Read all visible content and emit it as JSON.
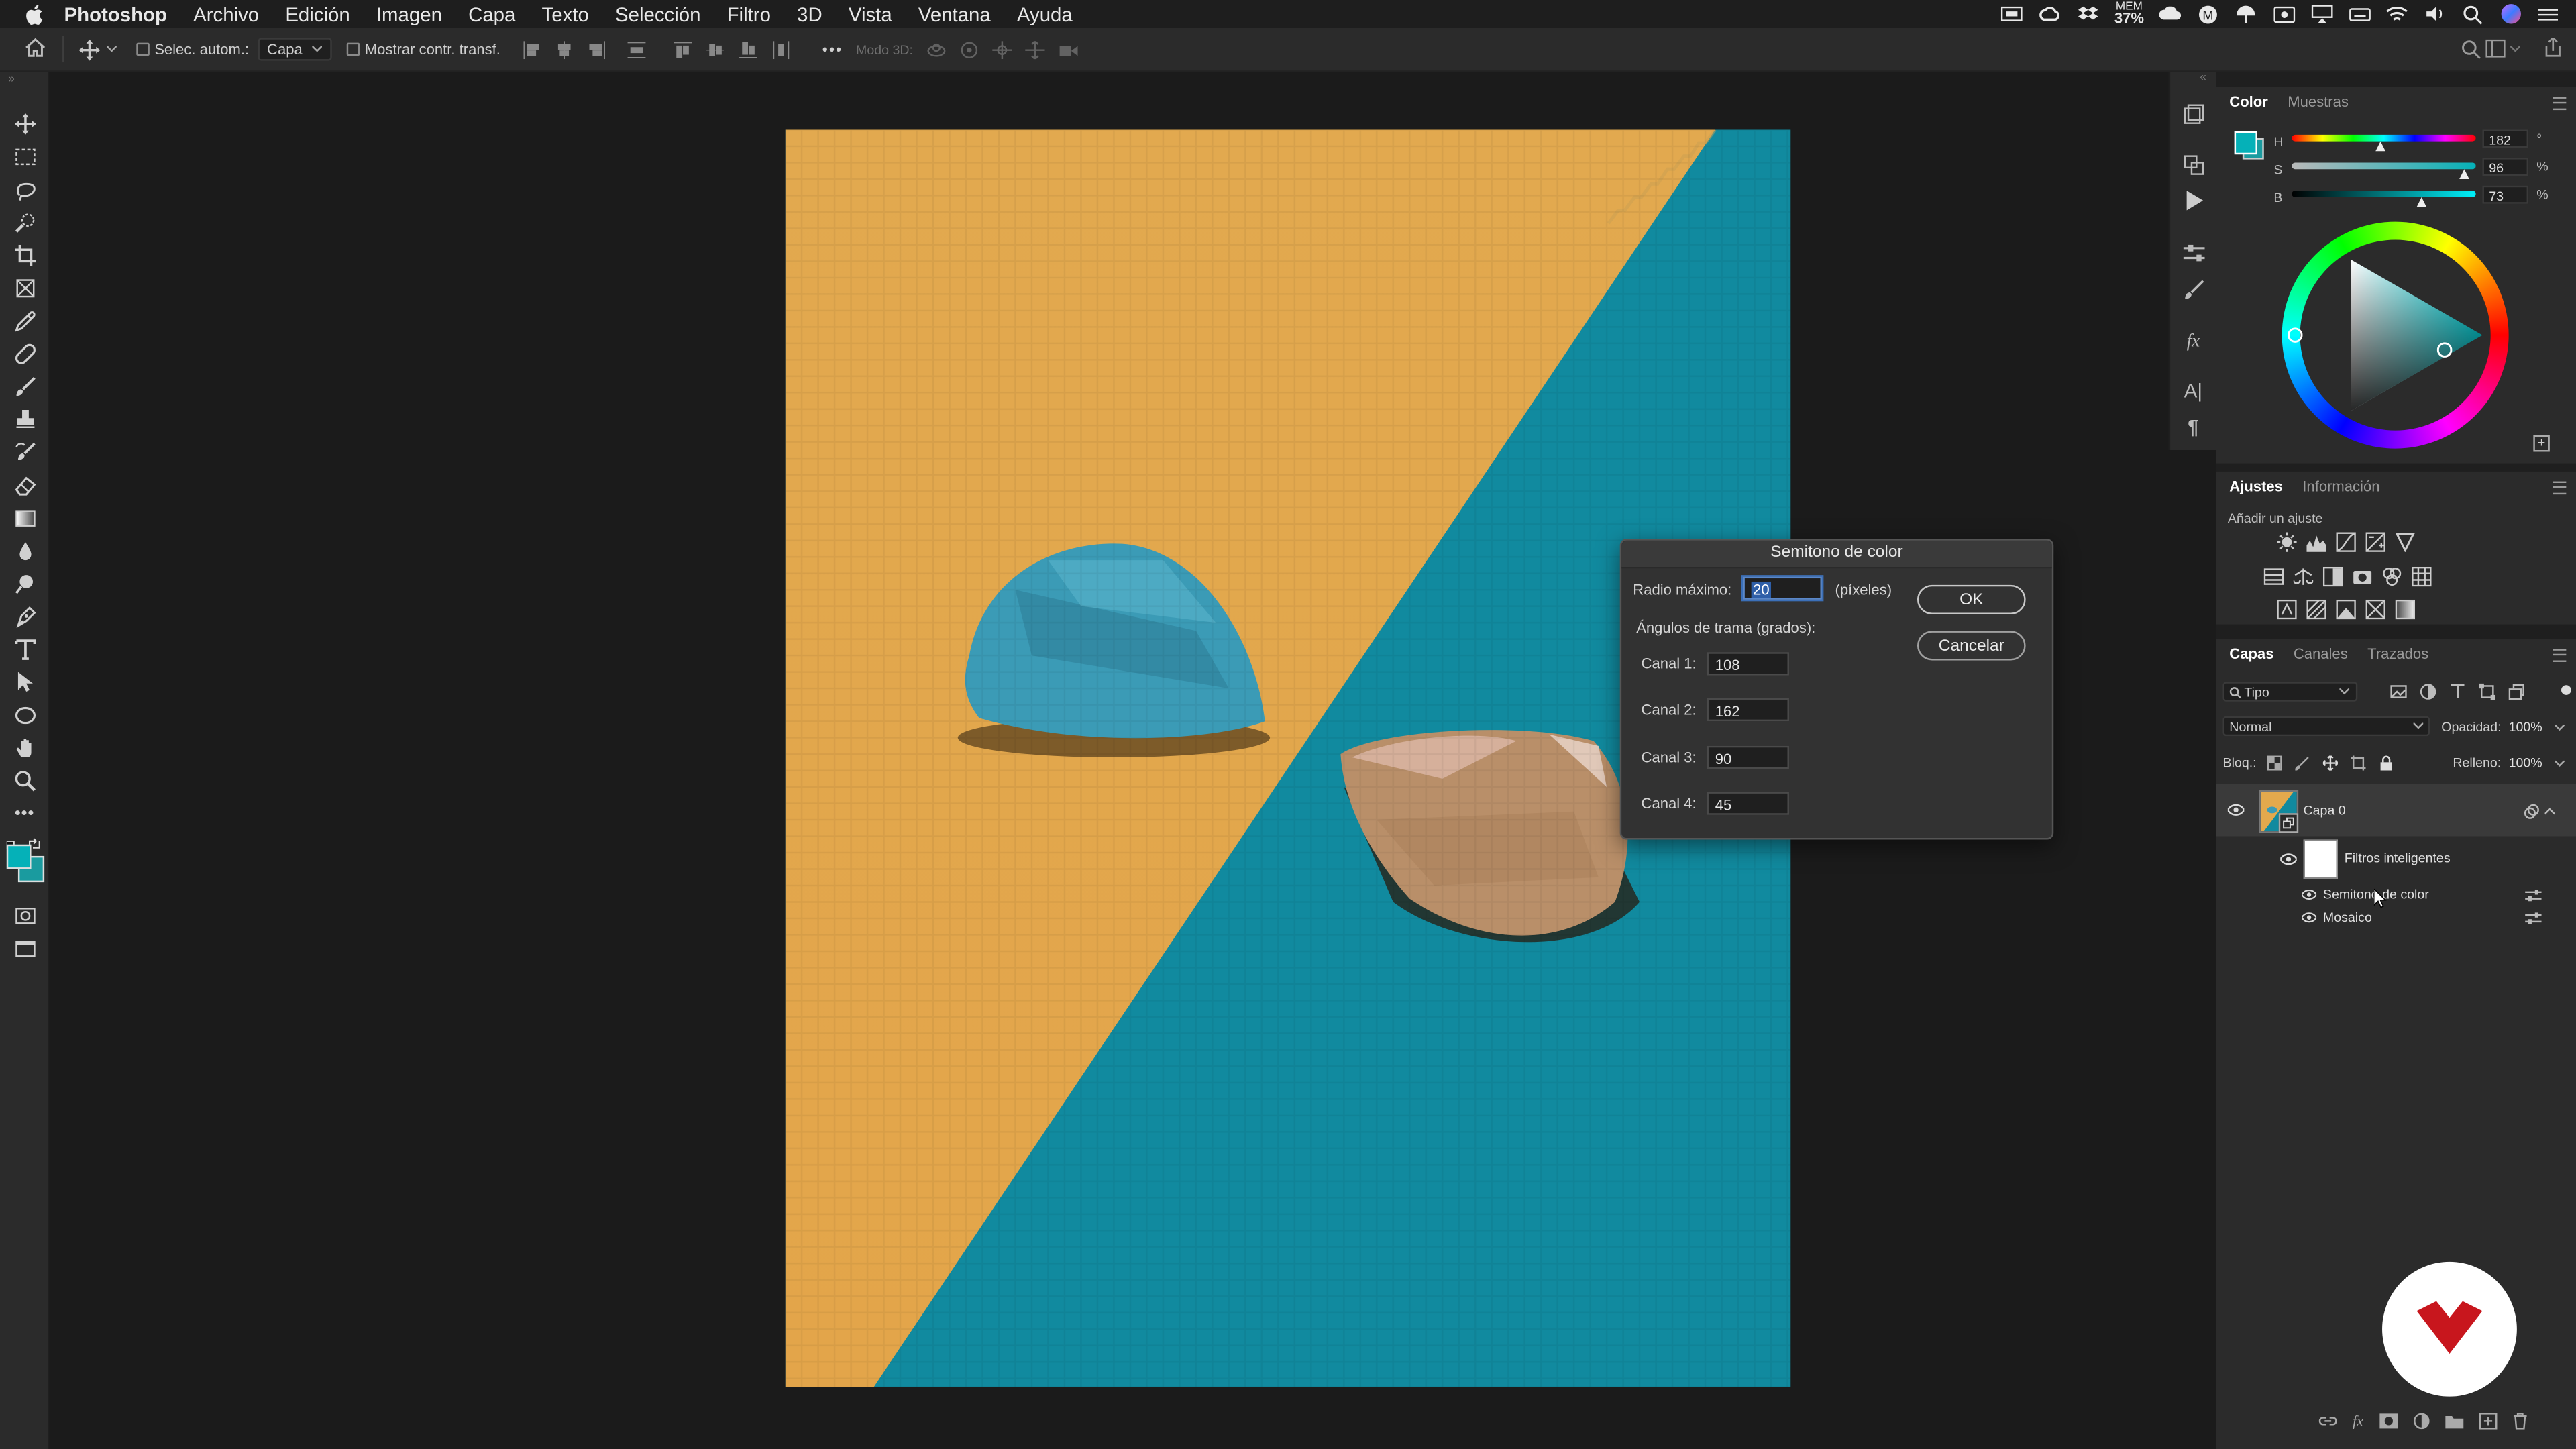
{
  "menubar": {
    "items": [
      "Photoshop",
      "Archivo",
      "Edición",
      "Imagen",
      "Capa",
      "Texto",
      "Selección",
      "Filtro",
      "3D",
      "Vista",
      "Ventana",
      "Ayuda"
    ],
    "memory_label": "MEM",
    "memory_value": "37%"
  },
  "options": {
    "auto_select_label": "Selec. autom.:",
    "auto_select_value": "Capa",
    "show_transform_label": "Mostrar contr. transf.",
    "mode3d_label": "Modo 3D:"
  },
  "color_panel": {
    "tabs": [
      "Color",
      "Muestras"
    ],
    "h_label": "H",
    "h_value": "182",
    "h_unit": "°",
    "s_label": "S",
    "s_value": "96",
    "s_unit": "%",
    "b_label": "B",
    "b_value": "73",
    "b_unit": "%",
    "foreground_color": "#05b1b8"
  },
  "adjust_panel": {
    "tabs": [
      "Ajustes",
      "Información"
    ],
    "subtitle": "Añadir un ajuste"
  },
  "layers_panel": {
    "tabs": [
      "Capas",
      "Canales",
      "Trazados"
    ],
    "filter_kind": "Tipo",
    "blend_mode": "Normal",
    "opacity_label": "Opacidad:",
    "opacity_value": "100%",
    "lock_label": "Bloq.:",
    "fill_label": "Relleno:",
    "fill_value": "100%",
    "layer_name": "Capa 0",
    "smart_filters_label": "Filtros inteligentes",
    "filters": [
      "Semitono de color",
      "Mosaico"
    ]
  },
  "dialog": {
    "title": "Semitono de color",
    "radius_label": "Radio máximo:",
    "radius_value": "20",
    "radius_unit": "(píxeles)",
    "angles_label": "Ángulos de trama (grados):",
    "channels": [
      {
        "label": "Canal 1:",
        "value": "108"
      },
      {
        "label": "Canal 2:",
        "value": "162"
      },
      {
        "label": "Canal 3:",
        "value": "90"
      },
      {
        "label": "Canal 4:",
        "value": "45"
      }
    ],
    "ok_label": "OK",
    "cancel_label": "Cancelar"
  },
  "colors": {
    "photo_yellow": "#e3a94d",
    "photo_teal": "#118a9f",
    "pick_blue": "#3b9bb6",
    "pick_tan": "#b98f69"
  }
}
